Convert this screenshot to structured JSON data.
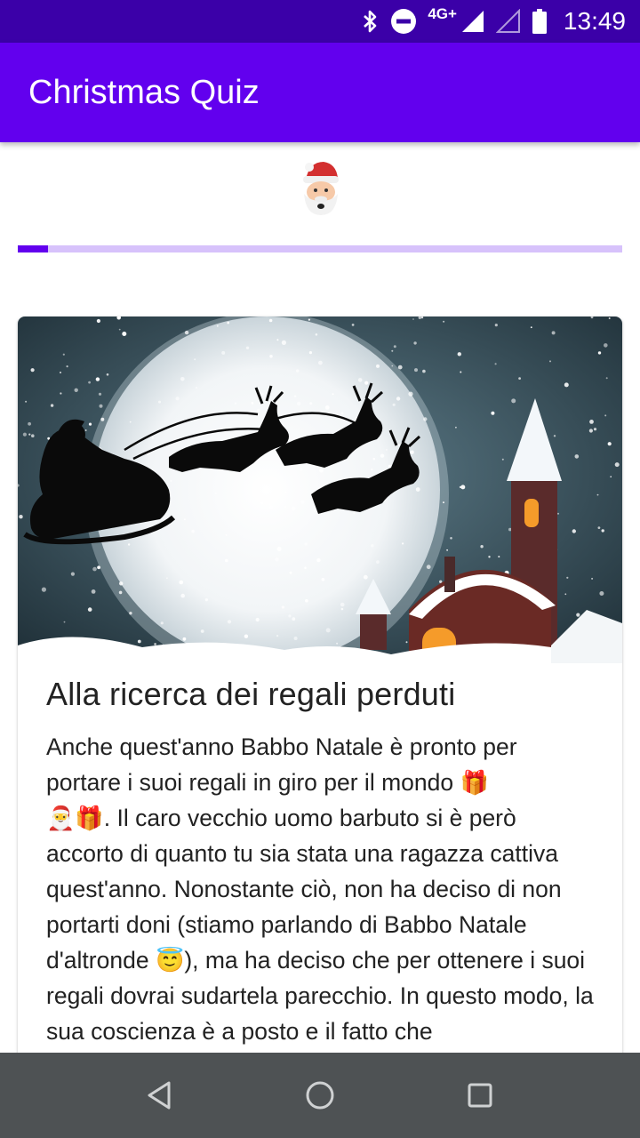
{
  "status_bar": {
    "time": "13:49",
    "network_label": "4G+",
    "icons": [
      "bluetooth-icon",
      "do-not-disturb-icon",
      "signal-icon",
      "signal-empty-icon",
      "battery-icon"
    ]
  },
  "app_bar": {
    "title": "Christmas Quiz"
  },
  "header": {
    "avatar_icon": "santa-emoji-icon"
  },
  "progress": {
    "value": 0.05,
    "color": "#6200ee",
    "track_color": "#d7c2fb"
  },
  "card": {
    "image_alt": "santa-sleigh-moon-illustration",
    "title": "Alla ricerca dei regali perduti",
    "body": {
      "p1": "Anche quest'anno Babbo Natale è pronto per portare i suoi regali in giro per il mondo ",
      "emoji1": "🎁",
      "emoji2": "🎅",
      "emoji3": "🎁",
      "p2": ". Il caro vecchio uomo barbuto si è però accorto di quanto tu sia stata una ragazza cattiva quest'anno. Nonostante ciò, non ha deciso di non portarti doni (stiamo parlando di Babbo Natale d'altronde ",
      "emoji4": "😇",
      "p3": "), ma ha deciso che per ottenere i suoi regali dovrai sudartela parecchio. In questo modo, la sua coscienza è a posto e il fatto che"
    }
  },
  "nav_bar": {
    "buttons": [
      "back-icon",
      "home-icon",
      "recents-icon"
    ]
  },
  "colors": {
    "primary": "#6200ee",
    "primary_dark": "#3b00a8",
    "nav_bar": "#4e5254"
  }
}
